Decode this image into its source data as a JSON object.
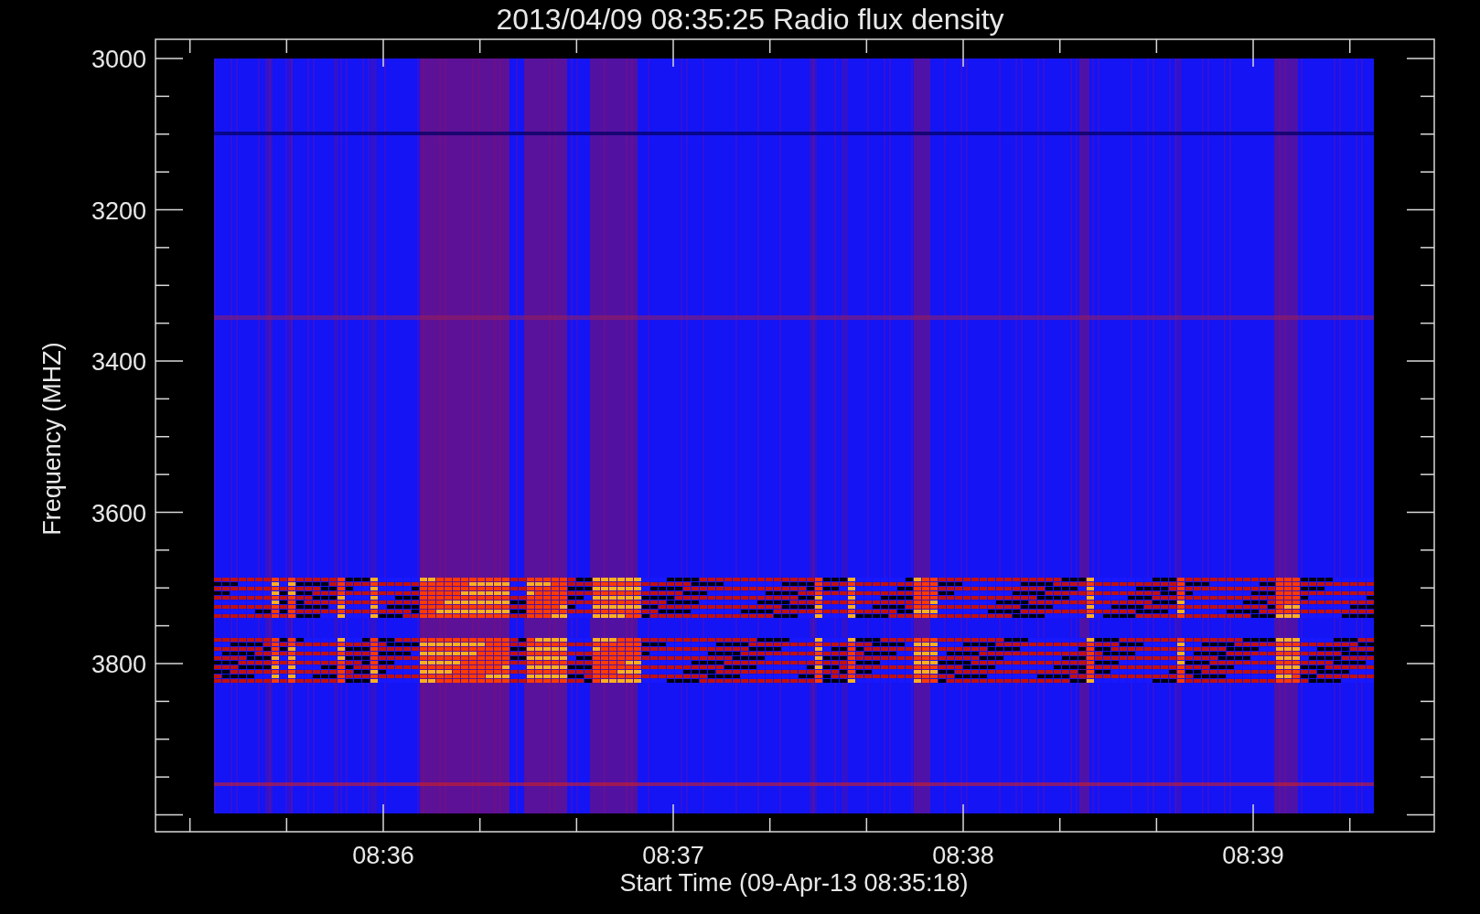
{
  "title": "2013/04/09 08:35:25 Radio flux density",
  "y_axis": {
    "label": "Frequency (MHZ)",
    "ticks": [
      "3000",
      "3200",
      "3400",
      "3600",
      "3800"
    ]
  },
  "x_axis": {
    "label": "Start Time (09-Apr-13 08:35:18)",
    "ticks": [
      "08:36",
      "08:37",
      "08:38",
      "08:39"
    ]
  }
}
